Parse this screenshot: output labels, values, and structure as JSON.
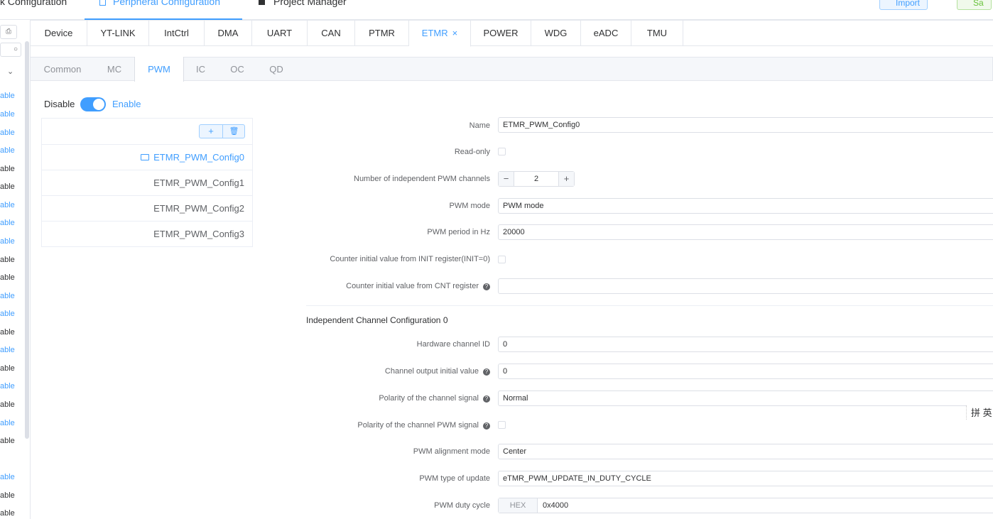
{
  "top": {
    "tabs": [
      {
        "label": "k Configuration"
      },
      {
        "label": "Peripheral Configuration"
      },
      {
        "label": "Project Manager"
      }
    ],
    "import_label": "Import",
    "save_label": "Sa"
  },
  "rail": {
    "items": [
      {
        "label": "able",
        "color": "#409eff"
      },
      {
        "label": "able",
        "color": "#409eff"
      },
      {
        "label": "able",
        "color": "#409eff"
      },
      {
        "label": "able",
        "color": "#409eff"
      },
      {
        "label": "able",
        "color": "#303133"
      },
      {
        "label": "able",
        "color": "#303133"
      },
      {
        "label": "able",
        "color": "#409eff"
      },
      {
        "label": "able",
        "color": "#409eff"
      },
      {
        "label": "able",
        "color": "#409eff"
      },
      {
        "label": "able",
        "color": "#303133"
      },
      {
        "label": "able",
        "color": "#303133"
      },
      {
        "label": "able",
        "color": "#409eff"
      },
      {
        "label": "able",
        "color": "#409eff"
      },
      {
        "label": "able",
        "color": "#303133"
      },
      {
        "label": "able",
        "color": "#409eff"
      },
      {
        "label": "able",
        "color": "#303133"
      },
      {
        "label": "able",
        "color": "#409eff"
      },
      {
        "label": "able",
        "color": "#303133"
      },
      {
        "label": "able",
        "color": "#409eff"
      },
      {
        "label": "able",
        "color": "#303133"
      },
      {
        "label": "able",
        "color": "#409eff"
      },
      {
        "label": "able",
        "color": "#303133"
      },
      {
        "label": "able",
        "color": "#303133"
      }
    ]
  },
  "main_tabs": [
    {
      "label": "Device"
    },
    {
      "label": "YT-LINK"
    },
    {
      "label": "IntCtrl"
    },
    {
      "label": "DMA"
    },
    {
      "label": "UART"
    },
    {
      "label": "CAN"
    },
    {
      "label": "PTMR"
    },
    {
      "label": "ETMR",
      "close": "×"
    },
    {
      "label": "POWER"
    },
    {
      "label": "WDG"
    },
    {
      "label": "eADC"
    },
    {
      "label": "TMU"
    }
  ],
  "sub_tabs": [
    {
      "label": "Common"
    },
    {
      "label": "MC"
    },
    {
      "label": "PWM"
    },
    {
      "label": "IC"
    },
    {
      "label": "OC"
    },
    {
      "label": "QD"
    }
  ],
  "switch": {
    "disable_label": "Disable",
    "enable_label": "Enable",
    "on": true
  },
  "configs": [
    {
      "name": "ETMR_PWM_Config0",
      "selected": true
    },
    {
      "name": "ETMR_PWM_Config1"
    },
    {
      "name": "ETMR_PWM_Config2"
    },
    {
      "name": "ETMR_PWM_Config3"
    }
  ],
  "form": {
    "name": {
      "label": "Name",
      "value": "ETMR_PWM_Config0"
    },
    "read_only": {
      "label": "Read-only",
      "checked": false
    },
    "num_channels": {
      "label": "Number of independent PWM channels",
      "value": "2",
      "minus": "−",
      "plus": "+"
    },
    "pwm_mode": {
      "label": "PWM mode",
      "value": "PWM mode"
    },
    "pwm_period": {
      "label": "PWM period in Hz",
      "value": "20000"
    },
    "counter_init": {
      "label": "Counter initial value from INIT register(INIT=0)",
      "checked": false
    },
    "counter_cnt": {
      "label": "Counter initial value from CNT register",
      "help": "?",
      "value": ""
    },
    "section_title": "Independent Channel Configuration 0",
    "hw_channel": {
      "label": "Hardware channel ID",
      "value": "0"
    },
    "ch_output_init": {
      "label": "Channel output initial value",
      "help": "?",
      "value": "0"
    },
    "polarity_signal": {
      "label": "Polarity of the channel signal",
      "help": "?",
      "value": "Normal"
    },
    "polarity_pwm": {
      "label": "Polarity of the channel PWM signal",
      "help": "?",
      "checked": false
    },
    "alignment": {
      "label": "PWM alignment mode",
      "value": "Center"
    },
    "update_type": {
      "label": "PWM type of update",
      "value": "eTMR_PWM_UPDATE_IN_DUTY_CYCLE"
    },
    "duty_cycle": {
      "label": "PWM duty cycle",
      "prefix": "HEX",
      "value": "0x4000"
    }
  },
  "ime": "拼 英",
  "colors": {
    "accent": "#409eff",
    "border": "#dcdfe6"
  }
}
